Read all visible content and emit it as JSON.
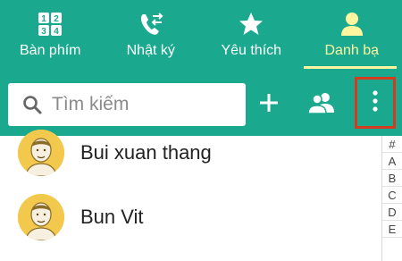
{
  "tabs": [
    {
      "label": "Bàn phím",
      "icon": "dialpad-icon",
      "active": false
    },
    {
      "label": "Nhật ký",
      "icon": "call-log-icon",
      "active": false
    },
    {
      "label": "Yêu thích",
      "icon": "star-icon",
      "active": false
    },
    {
      "label": "Danh bạ",
      "icon": "contacts-icon",
      "active": true
    }
  ],
  "toolbar": {
    "search_placeholder": "Tìm kiếm",
    "add_icon": "plus-icon",
    "groups_icon": "groups-icon",
    "more_icon": "more-vertical-icon"
  },
  "contacts": [
    {
      "name": "Bui xuan thang",
      "avatar": "default-avatar"
    },
    {
      "name": "Bun Vit",
      "avatar": "default-avatar"
    }
  ],
  "index": [
    "#",
    "A",
    "B",
    "C",
    "D",
    "E"
  ],
  "colors": {
    "header_bg": "#1aa98f",
    "active_tab": "#fff5a0",
    "highlight_border": "#d33a1e",
    "avatar_bg": "#f2c94c"
  }
}
